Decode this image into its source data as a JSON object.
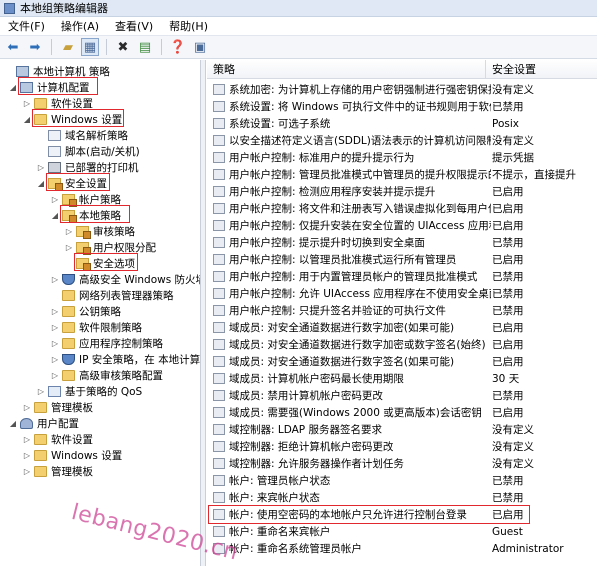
{
  "window": {
    "title": "本地组策略编辑器"
  },
  "menu": [
    "文件(F)",
    "操作(A)",
    "查看(V)",
    "帮助(H)"
  ],
  "tree": [
    {
      "label": "本地计算机 策略",
      "icon": "computer-icon",
      "arrow": ""
    },
    {
      "label": "计算机配置",
      "icon": "computer-icon",
      "arrow": "◢"
    },
    {
      "label": "软件设置",
      "icon": "folder-icon",
      "arrow": "▷"
    },
    {
      "label": "Windows 设置",
      "icon": "folder-icon",
      "arrow": "◢"
    },
    {
      "label": "域名解析策略",
      "icon": "doc-icon",
      "arrow": ""
    },
    {
      "label": "脚本(启动/关机)",
      "icon": "doc-icon",
      "arrow": ""
    },
    {
      "label": "已部署的打印机",
      "icon": "printer-icon",
      "arrow": "▷"
    },
    {
      "label": "安全设置",
      "icon": "lock-folder-icon",
      "arrow": "◢"
    },
    {
      "label": "帐户策略",
      "icon": "lock-folder-icon",
      "arrow": "▷"
    },
    {
      "label": "本地策略",
      "icon": "lock-folder-icon",
      "arrow": "◢"
    },
    {
      "label": "审核策略",
      "icon": "lock-folder-icon",
      "arrow": "▷"
    },
    {
      "label": "用户权限分配",
      "icon": "lock-folder-icon",
      "arrow": "▷"
    },
    {
      "label": "安全选项",
      "icon": "lock-folder-icon",
      "arrow": ""
    },
    {
      "label": "高级安全 Windows 防火墙",
      "icon": "shield-icon",
      "arrow": "▷"
    },
    {
      "label": "网络列表管理器策略",
      "icon": "folder-icon",
      "arrow": ""
    },
    {
      "label": "公钥策略",
      "icon": "folder-icon",
      "arrow": "▷"
    },
    {
      "label": "软件限制策略",
      "icon": "folder-icon",
      "arrow": "▷"
    },
    {
      "label": "应用程序控制策略",
      "icon": "folder-icon",
      "arrow": "▷"
    },
    {
      "label": "IP 安全策略，在 本地计算机",
      "icon": "shield-icon",
      "arrow": "▷"
    },
    {
      "label": "高级审核策略配置",
      "icon": "folder-icon",
      "arrow": "▷"
    },
    {
      "label": "基于策略的 QoS",
      "icon": "chart-icon",
      "arrow": "▷"
    },
    {
      "label": "管理模板",
      "icon": "folder-icon",
      "arrow": "▷"
    },
    {
      "label": "用户配置",
      "icon": "user-icon",
      "arrow": "◢"
    },
    {
      "label": "软件设置",
      "icon": "folder-icon",
      "arrow": "▷"
    },
    {
      "label": "Windows 设置",
      "icon": "folder-icon",
      "arrow": "▷"
    },
    {
      "label": "管理模板",
      "icon": "folder-icon",
      "arrow": "▷"
    }
  ],
  "columns": {
    "policy": "策略",
    "setting": "安全设置"
  },
  "rows": [
    {
      "policy": "系统加密: 为计算机上存储的用户密钥强制进行强密钥保护",
      "setting": "没有定义"
    },
    {
      "policy": "系统设置: 将 Windows 可执行文件中的证书规则用于软件...",
      "setting": "已禁用"
    },
    {
      "policy": "系统设置: 可选子系统",
      "setting": "Posix"
    },
    {
      "policy": "以安全描述符定义语言(SDDL)语法表示的计算机访问限制",
      "setting": "没有定义"
    },
    {
      "policy": "用户帐户控制: 标准用户的提升提示行为",
      "setting": "提示凭据"
    },
    {
      "policy": "用户帐户控制: 管理员批准模式中管理员的提升权限提示的...",
      "setting": "不提示，直接提升"
    },
    {
      "policy": "用户帐户控制: 检测应用程序安装并提示提升",
      "setting": "已启用"
    },
    {
      "policy": "用户帐户控制: 将文件和注册表写入错误虚拟化到每用户位置",
      "setting": "已启用"
    },
    {
      "policy": "用户帐户控制: 仅提升安装在安全位置的 UIAccess 应用程序",
      "setting": "已启用"
    },
    {
      "policy": "用户帐户控制: 提示提升时切换到安全桌面",
      "setting": "已禁用"
    },
    {
      "policy": "用户帐户控制: 以管理员批准模式运行所有管理员",
      "setting": "已启用"
    },
    {
      "policy": "用户帐户控制: 用于内置管理员帐户的管理员批准模式",
      "setting": "已禁用"
    },
    {
      "policy": "用户帐户控制: 允许 UIAccess 应用程序在不使用安全桌面...",
      "setting": "已禁用"
    },
    {
      "policy": "用户帐户控制: 只提升签名并验证的可执行文件",
      "setting": "已禁用"
    },
    {
      "policy": "域成员: 对安全通道数据进行数字加密(如果可能)",
      "setting": "已启用"
    },
    {
      "policy": "域成员: 对安全通道数据进行数字加密或数字签名(始终)",
      "setting": "已启用"
    },
    {
      "policy": "域成员: 对安全通道数据进行数字签名(如果可能)",
      "setting": "已启用"
    },
    {
      "policy": "域成员: 计算机帐户密码最长使用期限",
      "setting": "30 天"
    },
    {
      "policy": "域成员: 禁用计算机帐户密码更改",
      "setting": "已禁用"
    },
    {
      "policy": "域成员: 需要强(Windows 2000 或更高版本)会话密钥",
      "setting": "已启用"
    },
    {
      "policy": "域控制器: LDAP 服务器签名要求",
      "setting": "没有定义"
    },
    {
      "policy": "域控制器: 拒绝计算机帐户密码更改",
      "setting": "没有定义"
    },
    {
      "policy": "域控制器: 允许服务器操作者计划任务",
      "setting": "没有定义"
    },
    {
      "policy": "帐户: 管理员帐户状态",
      "setting": "已禁用"
    },
    {
      "policy": "帐户: 来宾帐户状态",
      "setting": "已禁用"
    },
    {
      "policy": "帐户: 使用空密码的本地帐户只允许进行控制台登录",
      "setting": "已启用"
    },
    {
      "policy": "帐户: 重命名来宾帐户",
      "setting": "Guest"
    },
    {
      "policy": "帐户: 重命名系统管理员帐户",
      "setting": "Administrator"
    }
  ],
  "watermark": "lebang2020.cn"
}
